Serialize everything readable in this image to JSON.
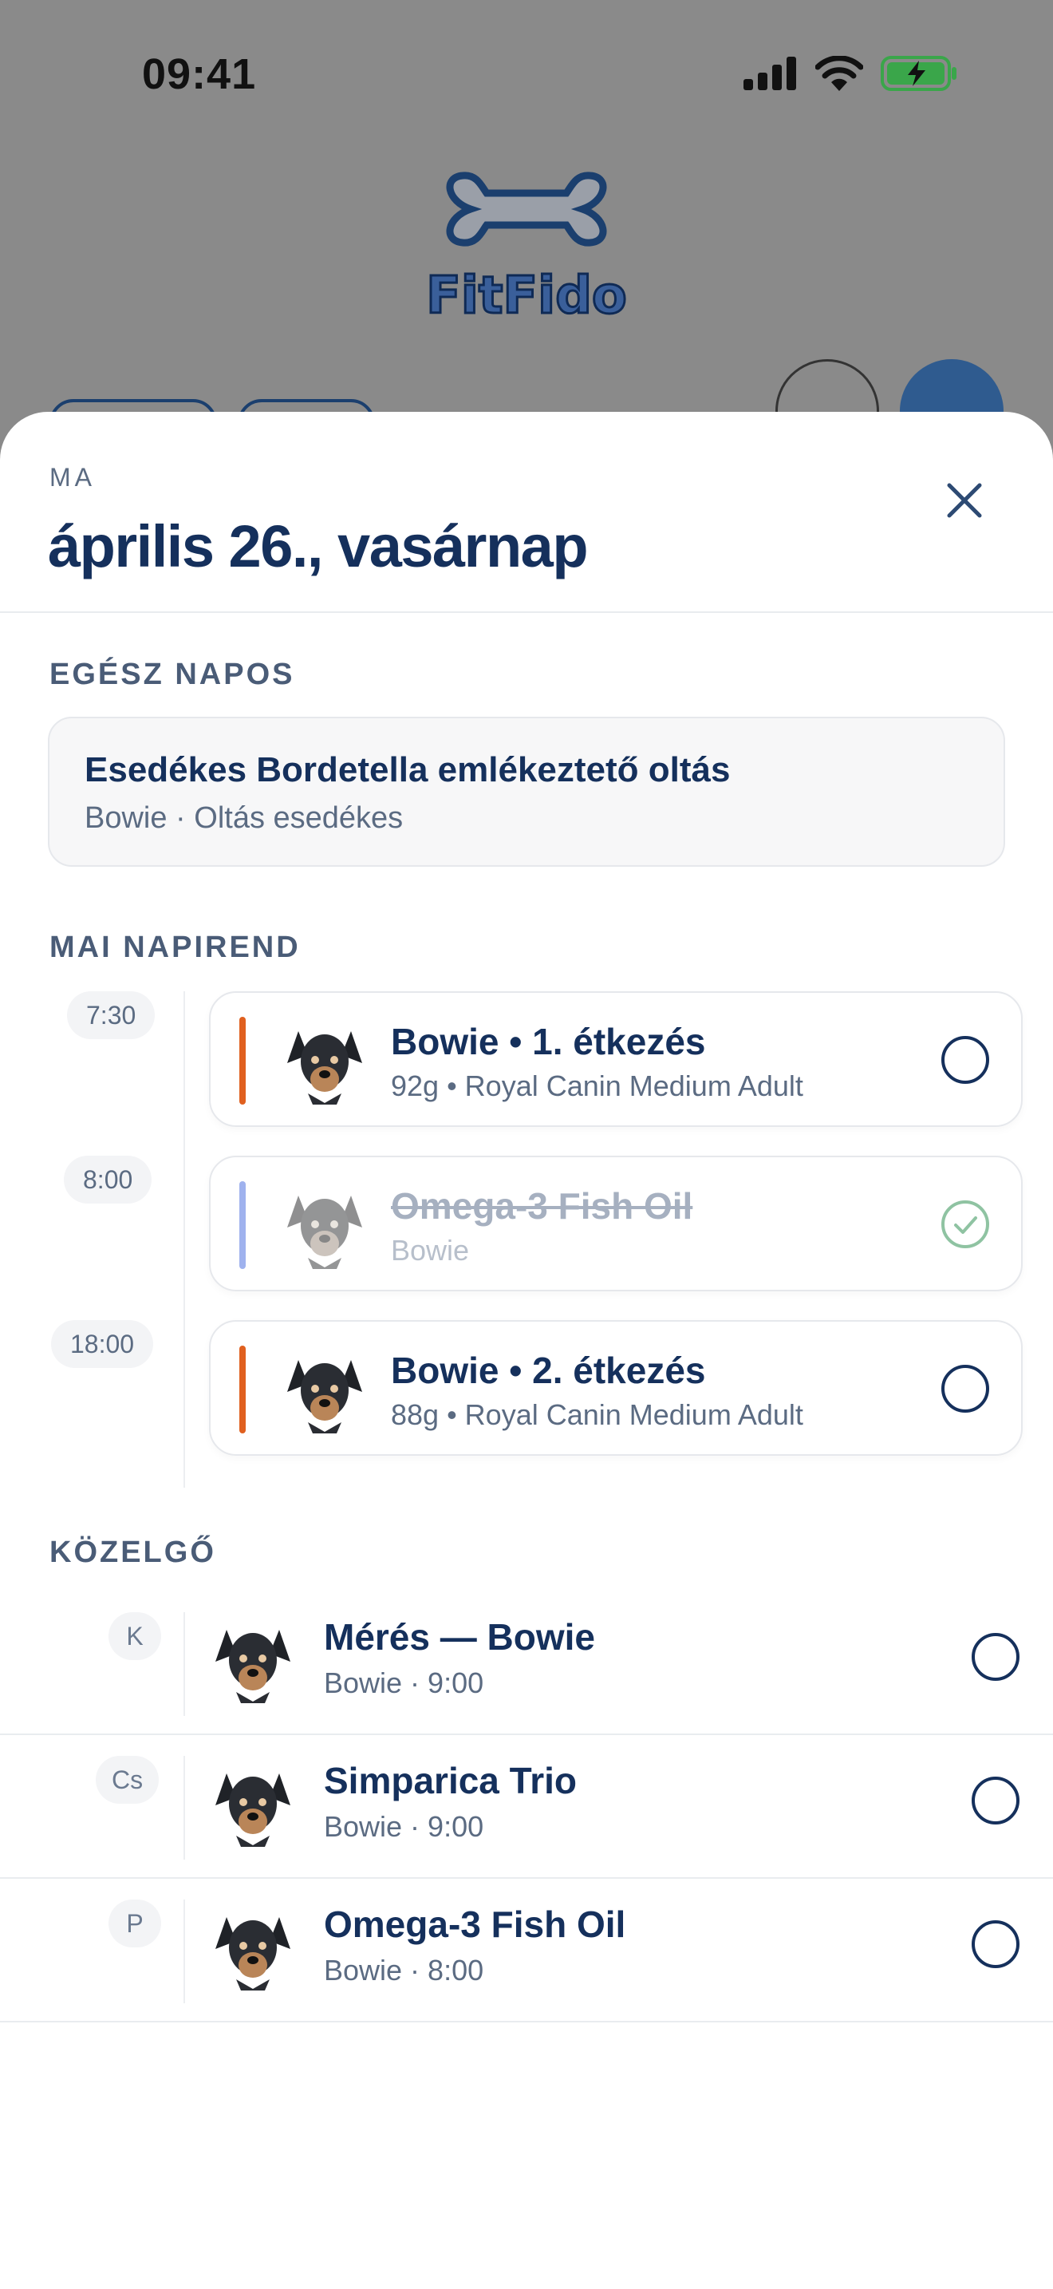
{
  "status_bar": {
    "time": "09:41"
  },
  "header": {
    "eyebrow": "MA",
    "date": "április 26., vasárnap"
  },
  "all_day": {
    "label": "EGÉSZ NAPOS",
    "title": "Esedékes Bordetella emlékeztető oltás",
    "subtitle": "Bowie · Oltás esedékes"
  },
  "schedule": {
    "label": "MAI NAPIREND",
    "items": [
      {
        "time": "7:30",
        "title": "Bowie • 1. étkezés",
        "subtitle": "92g • Royal Canin Medium Adult",
        "accent": "#e0601f",
        "done": false
      },
      {
        "time": "8:00",
        "title": "Omega-3 Fish Oil",
        "subtitle": "Bowie",
        "accent": "#9fb2ee",
        "done": true
      },
      {
        "time": "18:00",
        "title": "Bowie • 2. étkezés",
        "subtitle": "88g • Royal Canin Medium Adult",
        "accent": "#e0601f",
        "done": false
      }
    ]
  },
  "upcoming": {
    "label": "KÖZELGŐ",
    "items": [
      {
        "day": "K",
        "title": "Mérés — Bowie",
        "subtitle": "Bowie · 9:00"
      },
      {
        "day": "Cs",
        "title": "Simparica Trio",
        "subtitle": "Bowie · 9:00"
      },
      {
        "day": "P",
        "title": "Omega-3 Fish Oil",
        "subtitle": "Bowie · 8:00"
      }
    ]
  },
  "icons": {
    "close": "close-icon",
    "check_empty": "circle-icon",
    "check_done": "check-circle-icon",
    "avatar": "dog-avatar",
    "logo": "fitfido-logo"
  },
  "colors": {
    "primary": "#15305c",
    "muted": "#5b6b82",
    "meal_accent": "#e0601f",
    "supplement_accent": "#9fb2ee",
    "done_check": "#8fc3a2"
  }
}
